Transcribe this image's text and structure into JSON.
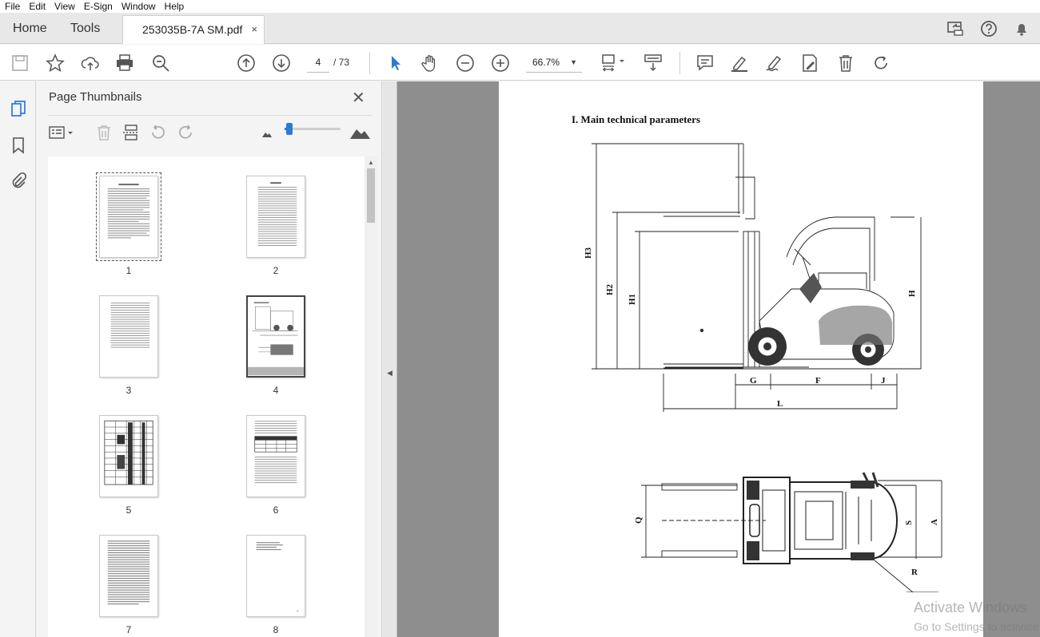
{
  "menu": [
    "File",
    "Edit",
    "View",
    "E-Sign",
    "Window",
    "Help"
  ],
  "tabs": {
    "home": "Home",
    "tools": "Tools",
    "document": "253035B-7A SM.pdf",
    "close": "×"
  },
  "toolbar": {
    "page_current": "4",
    "page_total": "/ 73",
    "zoom": "66.7%"
  },
  "panel": {
    "title": "Page Thumbnails",
    "close": "✕",
    "thumbnails": [
      {
        "label": "1",
        "selected": false
      },
      {
        "label": "2",
        "selected": false
      },
      {
        "label": "3",
        "selected": false
      },
      {
        "label": "4",
        "selected": true
      },
      {
        "label": "5",
        "selected": false
      },
      {
        "label": "6",
        "selected": false
      },
      {
        "label": "7",
        "selected": false
      },
      {
        "label": "8",
        "selected": false
      }
    ]
  },
  "document": {
    "heading": "I. Main technical parameters",
    "side_view_labels": {
      "h3": "H3",
      "h2": "H2",
      "h1": "H1",
      "h": "H",
      "g": "G",
      "f": "F",
      "j": "J",
      "l": "L"
    },
    "top_view_labels": {
      "q": "Q",
      "s": "S",
      "a": "A",
      "r": "R"
    }
  },
  "watermark": {
    "line1": "Activate Windows",
    "line2": "Go to Settings to activate Windows."
  },
  "colors": {
    "accent": "#2a7bd6",
    "doc_bg": "#8e8e8e",
    "panel_bg": "#f4f4f4"
  }
}
